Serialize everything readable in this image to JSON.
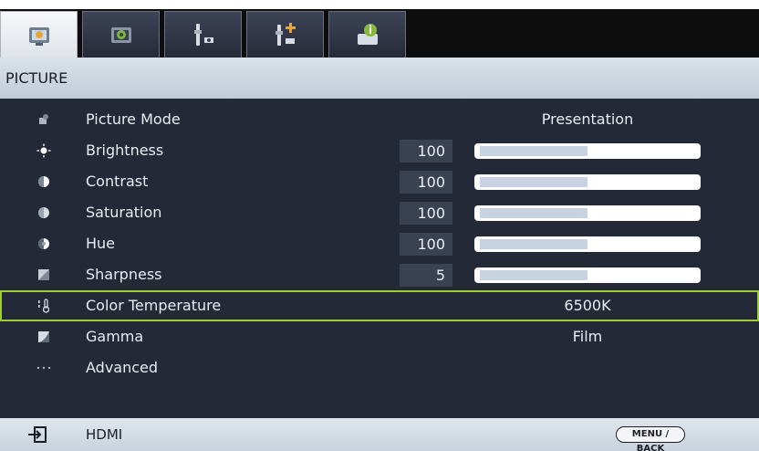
{
  "tabs": [
    {
      "name": "picture",
      "icon": "picture-icon",
      "active": true
    },
    {
      "name": "display",
      "icon": "display-icon",
      "active": false
    },
    {
      "name": "setup",
      "icon": "setup-icon",
      "active": false
    },
    {
      "name": "advanced-setup",
      "icon": "advanced-setup-icon",
      "active": false
    },
    {
      "name": "information",
      "icon": "information-icon",
      "active": false
    }
  ],
  "section": {
    "title": "PICTURE"
  },
  "menu": {
    "picture_mode": {
      "label": "Picture Mode",
      "value": "Presentation",
      "icon": "picture-mode-icon"
    },
    "brightness": {
      "label": "Brightness",
      "value": "100",
      "level": 0.5,
      "icon": "brightness-icon"
    },
    "contrast": {
      "label": "Contrast",
      "value": "100",
      "level": 0.5,
      "icon": "contrast-icon"
    },
    "saturation": {
      "label": "Saturation",
      "value": "100",
      "level": 0.5,
      "icon": "saturation-icon"
    },
    "hue": {
      "label": "Hue",
      "value": "100",
      "level": 0.5,
      "icon": "hue-icon"
    },
    "sharpness": {
      "label": "Sharpness",
      "value": "5",
      "level": 0.5,
      "icon": "sharpness-icon"
    },
    "color_temperature": {
      "label": "Color Temperature",
      "value": "6500K",
      "icon": "color-temperature-icon",
      "selected": true
    },
    "gamma": {
      "label": "Gamma",
      "value": "Film",
      "icon": "gamma-icon"
    },
    "advanced": {
      "label": "Advanced",
      "icon": "more-icon"
    }
  },
  "status": {
    "input": "HDMI",
    "menu_back": "MENU / BACK",
    "input_icon": "input-source-icon"
  },
  "colors": {
    "selection_border": "#9ccc3a",
    "panel_bg": "#232936",
    "header_bg": "#c3ccd7"
  }
}
